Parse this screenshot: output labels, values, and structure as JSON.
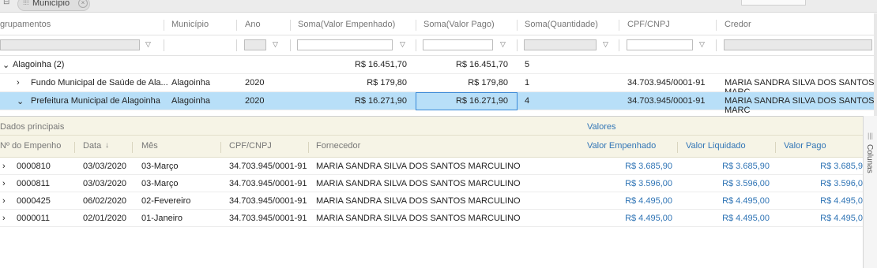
{
  "top": {
    "chip_label": "Município"
  },
  "grid": {
    "headers": {
      "groups": "grupamentos",
      "municipio": "Município",
      "ano": "Ano",
      "soma_empenhado": "Soma(Valor Empenhado)",
      "soma_pago": "Soma(Valor Pago)",
      "soma_quantidade": "Soma(Quantidade)",
      "cpf": "CPF/CNPJ",
      "credor": "Credor"
    },
    "group_row": {
      "label": "Alagoinha (2)",
      "empenhado": "R$ 16.451,70",
      "pago": "R$ 16.451,70",
      "quantidade": "5"
    },
    "rows": [
      {
        "name": "Fundo Municipal de Saúde de Ala...",
        "municipio": "Alagoinha",
        "ano": "2020",
        "empenhado": "R$ 179,80",
        "pago": "R$ 179,80",
        "quantidade": "1",
        "cpf": "34.703.945/0001-91",
        "credor": "MARIA SANDRA SILVA DOS SANTOS MARC"
      },
      {
        "name": "Prefeitura Municipal de Alagoinha",
        "municipio": "Alagoinha",
        "ano": "2020",
        "empenhado": "R$ 16.271,90",
        "pago": "R$ 16.271,90",
        "quantidade": "4",
        "cpf": "34.703.945/0001-91",
        "credor": "MARIA SANDRA SILVA DOS SANTOS MARC"
      }
    ]
  },
  "detail": {
    "group_main": "Dados principais",
    "group_values": "Valores",
    "headers": {
      "empenho": "Nº do Empenho",
      "data": "Data",
      "mes": "Mês",
      "cpf": "CPF/CNPJ",
      "fornecedor": "Fornecedor",
      "valor_empenhado": "Valor Empenhado",
      "valor_liquidado": "Valor Liquidado",
      "valor_pago": "Valor Pago"
    },
    "sort_arrow": "↓",
    "rows": [
      {
        "empenho": "0000810",
        "data": "03/03/2020",
        "mes": "03-Março",
        "cpf": "34.703.945/0001-91",
        "fornecedor": "MARIA SANDRA SILVA DOS SANTOS MARCULINO",
        "empenhado": "R$ 3.685,90",
        "liquidado": "R$ 3.685,90",
        "pago": "R$ 3.685,9"
      },
      {
        "empenho": "0000811",
        "data": "03/03/2020",
        "mes": "03-Março",
        "cpf": "34.703.945/0001-91",
        "fornecedor": "MARIA SANDRA SILVA DOS SANTOS MARCULINO",
        "empenhado": "R$ 3.596,00",
        "liquidado": "R$ 3.596,00",
        "pago": "R$ 3.596,0"
      },
      {
        "empenho": "0000425",
        "data": "06/02/2020",
        "mes": "02-Fevereiro",
        "cpf": "34.703.945/0001-91",
        "fornecedor": "MARIA SANDRA SILVA DOS SANTOS MARCULINO",
        "empenhado": "R$ 4.495,00",
        "liquidado": "R$ 4.495,00",
        "pago": "R$ 4.495,0"
      },
      {
        "empenho": "0000011",
        "data": "02/01/2020",
        "mes": "01-Janeiro",
        "cpf": "34.703.945/0001-91",
        "fornecedor": "MARIA SANDRA SILVA DOS SANTOS MARCULINO",
        "empenhado": "R$ 4.495,00",
        "liquidado": "R$ 4.495,00",
        "pago": "R$ 4.495,0"
      }
    ],
    "side_label": "Colunas"
  }
}
